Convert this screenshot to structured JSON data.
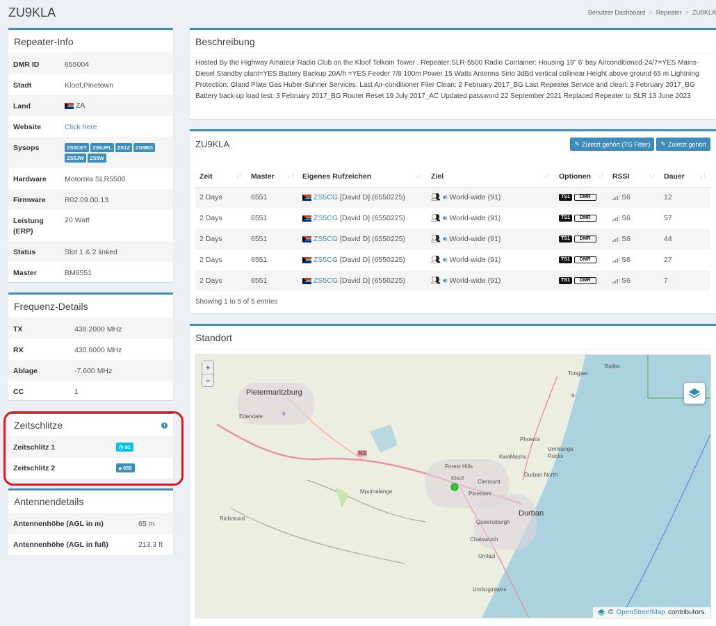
{
  "page": {
    "title": "ZU9KLA"
  },
  "breadcrumb": [
    "Benutzer Dashboard",
    "Repeater",
    "ZU9KLA"
  ],
  "repeater_info": {
    "title": "Repeater-Info",
    "rows": [
      {
        "label": "DMR ID",
        "value": "655004"
      },
      {
        "label": "Stadt",
        "value": "Kloof,Pinetown"
      },
      {
        "label": "Land",
        "value": "ZA"
      },
      {
        "label": "Website",
        "value": "Click here"
      },
      {
        "label": "Sysops",
        "value": ""
      },
      {
        "label": "Hardware",
        "value": "Motorola SLR5500"
      },
      {
        "label": "Firmware",
        "value": "R02.09.00.13"
      },
      {
        "label": "Leistung (ERP)",
        "value": "20 Watt"
      },
      {
        "label": "Status",
        "value": "Slot 1 & 2 linked"
      },
      {
        "label": "Master",
        "value": "BM6551"
      }
    ],
    "sysops": [
      "ZS5CEY",
      "ZS6JPL",
      "ZS1Z",
      "ZS5BG",
      "ZS5JW",
      "ZS5W"
    ]
  },
  "frequency": {
    "title": "Frequenz-Details",
    "rows": [
      {
        "label": "TX",
        "value": "438.2000 MHz"
      },
      {
        "label": "RX",
        "value": "430.6000 MHz"
      },
      {
        "label": "Ablage",
        "value": "-7.600 MHz"
      },
      {
        "label": "CC",
        "value": "1"
      }
    ]
  },
  "timeslots": {
    "title": "Zeitschlitze",
    "rows": [
      {
        "label": "Zeitschlitz 1",
        "badge": "91",
        "color": "#00c0ef"
      },
      {
        "label": "Zeitschlitz 2",
        "badge": "655",
        "color": "#3c8dbc"
      }
    ]
  },
  "antenna": {
    "title": "Antennendetails",
    "rows": [
      {
        "label": "Antennenhöhe (AGL in m)",
        "value": "65 m"
      },
      {
        "label": "Antennenhöhe (AGL in fuß)",
        "value": "213.3 ft"
      }
    ]
  },
  "description": {
    "title": "Beschreibung",
    "text": "Hosted By the Highway Amateur Radio Club on the Kloof Telkom Tower . Repeater:SLR-5500 Radio Container: Housing 19\" 6' bay Airconditioned-24/7=YES Mains-Diesel Standby plant=YES Battery Backup 20A/h =YES Feeder 7/8 100m Power 15 Watts Antenna Sirio 3dBd vertical collinear Height above ground 65 m Lightning Protection: Gland Plate Gas Huber-Suhner Services: Last Air-conditioner Filer Clean: 2 February 2017_BG Last Repeater Service and clean: 3 February 2017_BG Battery back-up load test: 3 February 2017_BG Router Reset 19 July 2017_AC Updated password 22 September 2021 Replaced Repeater to SLR 13 June 2023"
  },
  "lastheard": {
    "title": "ZU9KLA",
    "btn_filter": "Zuletzt gehört (TG Filter)",
    "btn_all": "Zuletzt gehört",
    "columns": [
      "Zeit",
      "Master",
      "Eigenes Rufzeichen",
      "Ziel",
      "Optionen",
      "RSSI",
      "Dauer"
    ],
    "rows": [
      {
        "time": "2 Days",
        "master": "6551",
        "call": "ZS5CG",
        "name": "[David D] (6550225)",
        "target": "World-wide (91)",
        "ts": "TS1",
        "mode": "DMR",
        "rssi": "S6",
        "duration": "12"
      },
      {
        "time": "2 Days",
        "master": "6551",
        "call": "ZS5CG",
        "name": "[David D] (6550225)",
        "target": "World-wide (91)",
        "ts": "TS1",
        "mode": "DMR",
        "rssi": "S6",
        "duration": "57"
      },
      {
        "time": "2 Days",
        "master": "6551",
        "call": "ZS5CG",
        "name": "[David D] (6550225)",
        "target": "World-wide (91)",
        "ts": "TS1",
        "mode": "DMR",
        "rssi": "S6",
        "duration": "44"
      },
      {
        "time": "2 Days",
        "master": "6551",
        "call": "ZS5CG",
        "name": "[David D] (6550225)",
        "target": "World-wide (91)",
        "ts": "TS1",
        "mode": "DMR",
        "rssi": "S6",
        "duration": "27"
      },
      {
        "time": "2 Days",
        "master": "6551",
        "call": "ZS5CG",
        "name": "[David D] (6550225)",
        "target": "World-wide (91)",
        "ts": "TS1",
        "mode": "DMR",
        "rssi": "S6",
        "duration": "7"
      }
    ],
    "showing": "Showing 1 to 5 of 5 entries"
  },
  "location": {
    "title": "Standort",
    "zoom_in": "+",
    "zoom_out": "−",
    "attribution_prefix": "©",
    "attribution_link": "OpenStreetMap",
    "attribution_suffix": "contributors.",
    "labels": [
      "Pietermaritzburg",
      "Edendale",
      "Ballito",
      "Tongaat",
      "Phoenix",
      "Umhlanga Rocks",
      "KwaMashu",
      "Forest Hills",
      "Kloof",
      "Clermont",
      "Durban North",
      "Pinetown",
      "Mpumalanga",
      "Queensburgh",
      "Durban",
      "Richmond",
      "Chatsworth",
      "Umlazi",
      "Umbogintwini",
      "N3"
    ]
  }
}
